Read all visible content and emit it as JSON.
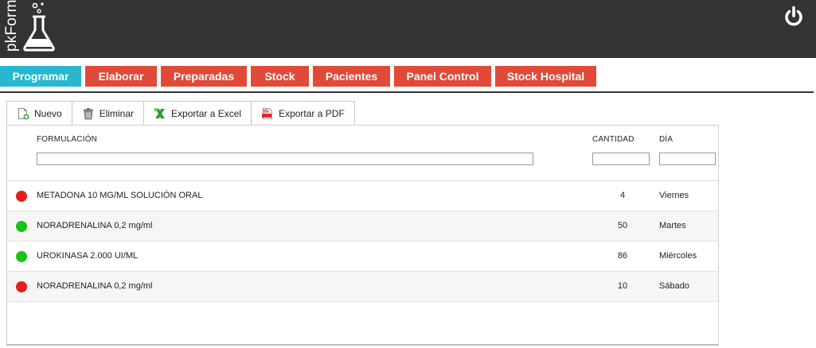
{
  "app": {
    "logo_text": "pkForm"
  },
  "colors": {
    "accent": "#27b7cf",
    "tab": "#e04a38",
    "header_bg": "#333333",
    "status_red": "#e0201c",
    "status_green": "#18c418"
  },
  "nav": {
    "tabs": [
      {
        "label": "Programar",
        "active": true
      },
      {
        "label": "Elaborar"
      },
      {
        "label": "Preparadas"
      },
      {
        "label": "Stock"
      },
      {
        "label": "Pacientes"
      },
      {
        "label": "Panel Control"
      },
      {
        "label": "Stock Hospital"
      }
    ]
  },
  "toolbar": {
    "new_label": "Nuevo",
    "delete_label": "Eliminar",
    "excel_label": "Exportar a Excel",
    "pdf_label": "Exportar a PDF"
  },
  "table": {
    "columns": {
      "formulation": "FORMULACIÓN",
      "quantity": "CANTIDAD",
      "day": "DÍA"
    },
    "filters": {
      "formulation": "",
      "quantity": "",
      "day": ""
    },
    "rows": [
      {
        "status": "red",
        "formulation": "METADONA 10 MG/ML SOLUCIÓN ORAL",
        "quantity": "4",
        "day": "Viernes"
      },
      {
        "status": "green",
        "formulation": "NORADRENALINA 0,2 mg/ml",
        "quantity": "50",
        "day": "Martes"
      },
      {
        "status": "green",
        "formulation": "UROKINASA 2.000 UI/ML",
        "quantity": "86",
        "day": "Miércoles"
      },
      {
        "status": "red",
        "formulation": "NORADRENALINA 0,2 mg/ml",
        "quantity": "10",
        "day": "Sábado"
      }
    ]
  }
}
